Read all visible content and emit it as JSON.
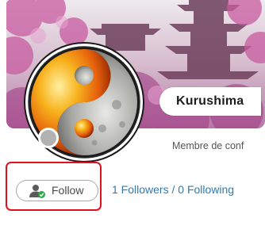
{
  "profile": {
    "name": "Kurushima",
    "role": "Membre de conf",
    "presence_color": "#b2b2b2"
  },
  "actions": {
    "follow_label": "Follow",
    "followers": "1 Followers",
    "separator": " / ",
    "following": "0 Following"
  },
  "icons": {
    "follow": "user-check-icon",
    "avatar": "yin-yang-avatar"
  },
  "colors": {
    "link": "#2e7bb4",
    "highlight": "#e01020",
    "check": "#2ba84a"
  }
}
